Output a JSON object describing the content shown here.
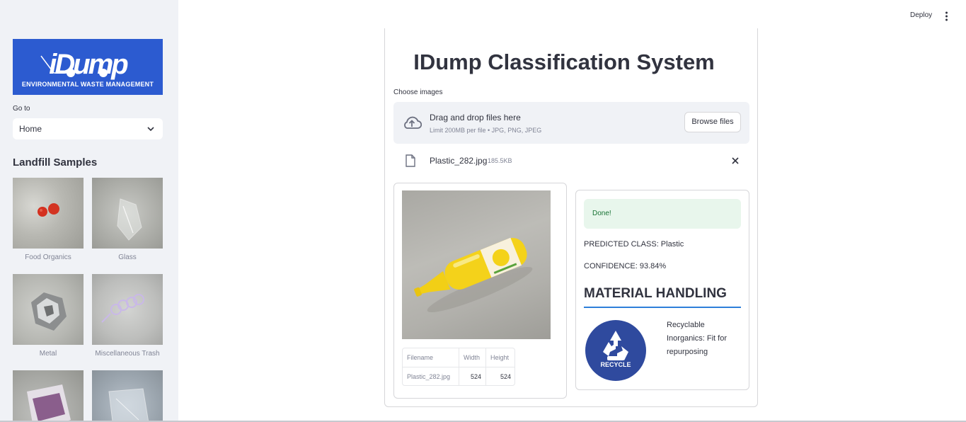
{
  "sidebar": {
    "logo": {
      "word": "iDump",
      "subtitle": "ENVIRONMENTAL WASTE MANAGEMENT"
    },
    "goto_label": "Go to",
    "select_value": "Home",
    "samples_title": "Landfill Samples",
    "samples": [
      {
        "caption": "Food Organics"
      },
      {
        "caption": "Glass"
      },
      {
        "caption": "Metal"
      },
      {
        "caption": "Miscellaneous Trash"
      },
      {
        "caption": ""
      },
      {
        "caption": ""
      }
    ]
  },
  "header": {
    "deploy_label": "Deploy",
    "menu_icon": "vertical-dots-icon"
  },
  "main": {
    "title": "IDump Classification System",
    "uploader": {
      "label": "Choose images",
      "drop_title": "Drag and drop files here",
      "limit_text": "Limit 200MB per file • JPG, PNG, JPEG",
      "browse_label": "Browse files",
      "cloud_icon": "cloud-upload-icon"
    },
    "file": {
      "name": "Plastic_282.jpg",
      "size": "185.5KB",
      "icon": "file-icon",
      "close_icon": "close-icon"
    },
    "meta_table": {
      "headers": [
        "Filename",
        "Width",
        "Height"
      ],
      "row": [
        "Plastic_282.jpg",
        "524",
        "524"
      ]
    },
    "result": {
      "status": "Done!",
      "predicted": "PREDICTED CLASS: Plastic",
      "confidence": "CONFIDENCE: 93.84%",
      "handling_title": "MATERIAL HANDLING",
      "recycle_badge": "RECYCLE",
      "handling_text": "Recyclable Inorganics: Fit for repurposing"
    }
  },
  "colors": {
    "logo_bg": "#2c5bd0",
    "recycle_bg": "#2f4a9e",
    "success_bg": "#e8f6ec",
    "success_text": "#177233",
    "rule": "#2e7fd9"
  }
}
